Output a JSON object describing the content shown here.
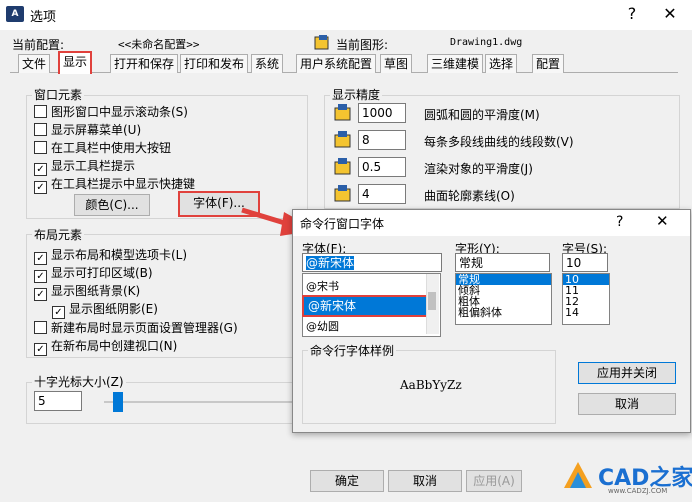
{
  "window": {
    "title": "选项",
    "app_icon": "A"
  },
  "header": {
    "current_profile_label": "当前配置:",
    "current_profile_value": "<<未命名配置>>",
    "current_drawing_label": "当前图形:",
    "current_drawing_value": "Drawing1.dwg"
  },
  "tabs": [
    "文件",
    "显示",
    "打开和保存",
    "打印和发布",
    "系统",
    "用户系统配置",
    "草图",
    "三维建模",
    "选择",
    "配置"
  ],
  "window_elements": {
    "title": "窗口元素",
    "items": [
      {
        "label": "图形窗口中显示滚动条(S)",
        "checked": false
      },
      {
        "label": "显示屏幕菜单(U)",
        "checked": false
      },
      {
        "label": "在工具栏中使用大按钮",
        "checked": false
      },
      {
        "label": "显示工具栏提示",
        "checked": true
      },
      {
        "label": "在工具栏提示中显示快捷键",
        "checked": true
      }
    ],
    "colors_button": "颜色(C)...",
    "fonts_button": "字体(F)..."
  },
  "layout_elements": {
    "title": "布局元素",
    "items": [
      {
        "label": "显示布局和模型选项卡(L)",
        "checked": true
      },
      {
        "label": "显示可打印区域(B)",
        "checked": true
      },
      {
        "label": "显示图纸背景(K)",
        "checked": true
      },
      {
        "label": "显示图纸阴影(E)",
        "checked": true
      },
      {
        "label": "新建布局时显示页面设置管理器(G)",
        "checked": false
      },
      {
        "label": "在新布局中创建视口(N)",
        "checked": true
      }
    ]
  },
  "crosshair": {
    "title": "十字光标大小(Z)",
    "value": "5",
    "slider_fraction": 0.05
  },
  "display_resolution": {
    "title": "显示精度",
    "items": [
      {
        "value": "1000",
        "label": "圆弧和圆的平滑度(M)"
      },
      {
        "value": "8",
        "label": "每条多段线曲线的线段数(V)"
      },
      {
        "value": "0.5",
        "label": "渲染对象的平滑度(J)"
      },
      {
        "value": "4",
        "label": "曲面轮廓素线(O)"
      }
    ]
  },
  "dialog": {
    "title": "命令行窗口字体",
    "help": "?",
    "font_label": "字体(F):",
    "font_value": "@新宋体",
    "font_list": [
      "@宋书",
      "@新宋体",
      "@幼圆"
    ],
    "style_label": "字形(Y):",
    "style_value": "常规",
    "style_list": [
      "常规",
      "倾斜",
      "粗体",
      "粗偏斜体"
    ],
    "size_label": "字号(S):",
    "size_value": "10",
    "size_list": [
      "10",
      "11",
      "12",
      "14"
    ],
    "sample_title": "命令行字体样例",
    "sample_text": "AaBbYyZz",
    "apply_close": "应用并关闭",
    "cancel": "取消"
  },
  "footer": {
    "ok": "确定",
    "cancel": "取消",
    "apply": "应用(A)"
  },
  "watermark": {
    "brand": "CAD之家",
    "url": "www.CADZJ.COM"
  },
  "colors": {
    "highlight": "#e0413c",
    "selection": "#0078d7",
    "arrow": "#e0413c"
  }
}
